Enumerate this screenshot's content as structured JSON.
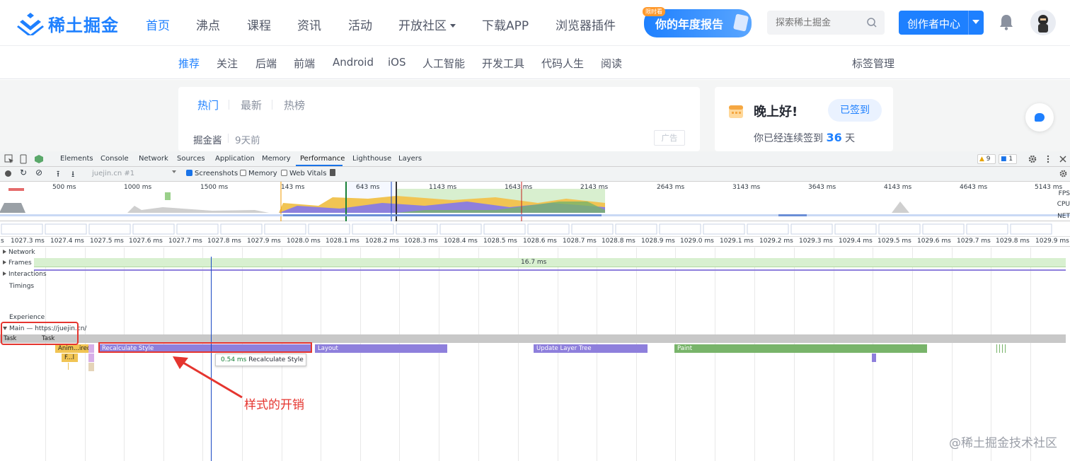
{
  "header": {
    "logo_text": "稀土掘金",
    "nav": [
      {
        "label": "首页",
        "active": true
      },
      {
        "label": "沸点"
      },
      {
        "label": "课程"
      },
      {
        "label": "资讯"
      },
      {
        "label": "活动"
      },
      {
        "label": "开放社区"
      },
      {
        "label": "下载APP"
      },
      {
        "label": "浏览器插件"
      }
    ],
    "report_label": "你的年度报告",
    "report_tag": "限时看",
    "search_placeholder": "探索稀土掘金",
    "creator_label": "创作者中心"
  },
  "subnav": [
    "推荐",
    "关注",
    "后端",
    "前端",
    "Android",
    "iOS",
    "人工智能",
    "开发工具",
    "代码人生",
    "阅读"
  ],
  "subnav_right": "标签管理",
  "feed": {
    "tabs": [
      "热门",
      "最新",
      "热榜"
    ],
    "author": "掘金酱",
    "time": "9天前",
    "ad": "广告"
  },
  "side": {
    "greeting": "晚上好!",
    "signed_label": "已签到",
    "streak_prefix": "你已经连续签到",
    "streak_days": "36",
    "streak_suffix": "天"
  },
  "devtools": {
    "tabs": [
      "Elements",
      "Console",
      "Network",
      "Sources",
      "Application",
      "Memory",
      "Performance",
      "Lighthouse",
      "Layers"
    ],
    "active_tab": "Performance",
    "warn_count": "9",
    "msg_count": "1",
    "profile_select": "juejin.cn #1",
    "screenshots_label": "Screenshots",
    "memory_label": "Memory",
    "webvitals_label": "Web Vitals",
    "overview_labels": [
      "500 ms",
      "1000 ms",
      "1500 ms",
      "143 ms",
      "643 ms",
      "1143 ms",
      "1643 ms",
      "2143 ms",
      "2643 ms",
      "3143 ms",
      "3643 ms",
      "4143 ms",
      "4643 ms",
      "5143 ms"
    ],
    "overview_side": [
      "FPS",
      "CPU",
      "NET"
    ],
    "ruler_labels": [
      "s",
      "1027.3 ms",
      "1027.4 ms",
      "1027.5 ms",
      "1027.6 ms",
      "1027.7 ms",
      "1027.8 ms",
      "1027.9 ms",
      "1028.0 ms",
      "1028.1 ms",
      "1028.2 ms",
      "1028.3 ms",
      "1028.4 ms",
      "1028.5 ms",
      "1028.6 ms",
      "1028.7 ms",
      "1028.8 ms",
      "1028.9 ms",
      "1029.0 ms",
      "1029.1 ms",
      "1029.2 ms",
      "1029.3 ms",
      "1029.4 ms",
      "1029.5 ms",
      "1029.6 ms",
      "1029.7 ms",
      "1029.8 ms",
      "1029.9 ms"
    ],
    "tracks": {
      "network": "Network",
      "frames": "Frames",
      "frame_time": "16.7 ms",
      "interactions": "Interactions",
      "timings": "Timings",
      "experience": "Experience",
      "main": "Main — https://juejin.cn/"
    },
    "bars": {
      "task1": "Task",
      "task2": "Task",
      "anim": "Anim...ired",
      "fl": "F...l",
      "recalc": "Recalculate Style",
      "layout": "Layout",
      "update": "Update Layer Tree",
      "paint": "Paint"
    },
    "tooltip_ms": "0.54 ms",
    "tooltip_label": "Recalculate Style",
    "colors": {
      "style": "#8e7fdc",
      "paint": "#78b46a",
      "script": "#f1c453",
      "task": "#c8c8c8",
      "accent": "#1a73e8"
    }
  },
  "annotation": "样式的开销",
  "watermark": "@稀土掘金技术社区"
}
